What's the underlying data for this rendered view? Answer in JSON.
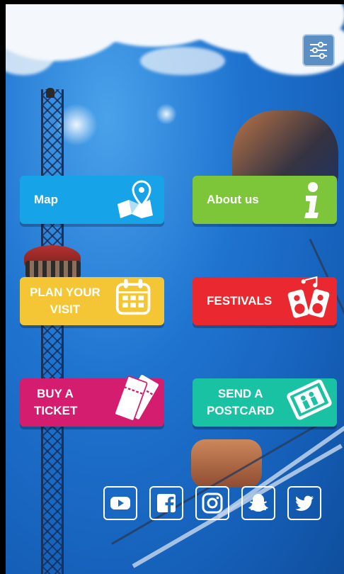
{
  "colors": {
    "map": "#16a3e8",
    "about": "#7dc63a",
    "plan": "#f4c534",
    "festivals": "#e9292f",
    "ticket": "#d51d70",
    "postcard": "#19c2a2"
  },
  "toolbar": {
    "settings_icon": "sliders-icon"
  },
  "tiles": {
    "map": {
      "label": "Map",
      "icon": "map-pin-icon"
    },
    "about": {
      "label": "About us",
      "icon": "info-icon"
    },
    "plan": {
      "line1": "PLAN YOUR",
      "line2": "VISIT",
      "icon": "calendar-icon"
    },
    "festivals": {
      "label": "FESTIVALS",
      "icon": "speakers-music-icon"
    },
    "ticket": {
      "line1": "BUY A",
      "line2": "TICKET",
      "icon": "tickets-icon"
    },
    "postcard": {
      "line1": "SEND A",
      "line2": "POSTCARD",
      "icon": "postcard-icon"
    }
  },
  "social": [
    "youtube-icon",
    "facebook-icon",
    "instagram-icon",
    "snapchat-icon",
    "twitter-icon"
  ]
}
